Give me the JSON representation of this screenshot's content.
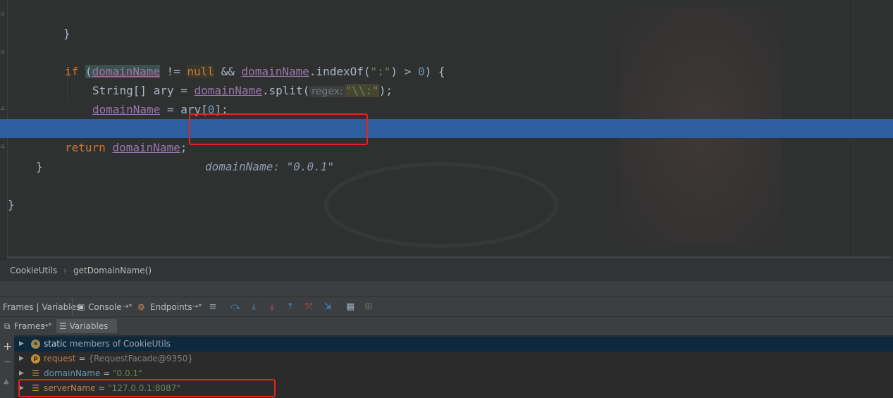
{
  "editor": {
    "lines": [
      {
        "brace": "}"
      },
      {
        "kw_if": "if",
        "paren_open": "(",
        "var1": "domainName",
        "op1": " != ",
        "null_kw": "null",
        "op2": " && ",
        "var2": "domainName",
        "call": ".indexOf(",
        "str1": "\":\"",
        "rest": ") > ",
        "num": "0",
        "close": ") {"
      },
      {
        "type": "String[] ary = ",
        "var": "domainName",
        "call": ".split(",
        "hint": "regex:",
        "str": "\"\\\\:\"",
        "end": ");"
      },
      {
        "var": "domainName",
        "mid": " = ary[",
        "num": "0",
        "end": "];"
      },
      {
        "brace": "}"
      },
      {
        "kw": "return",
        "var": "domainName",
        "end": ";",
        "inline_value": "domainName: \"0.0.1\""
      },
      {
        "brace": "}"
      },
      {
        "brace": "}"
      }
    ]
  },
  "breadcrumb": {
    "class": "CookieUtils",
    "method": "getDomainName()"
  },
  "debug_tabs": {
    "frames_variables": "Frames | Variables",
    "console": "Console",
    "console_pin": "→*",
    "endpoints": "Endpoints",
    "endpoints_pin": "→*"
  },
  "subtabs": {
    "frames": "Frames",
    "frames_pin": "→*",
    "variables": "Variables",
    "variables_pin": "→*"
  },
  "variables": [
    {
      "icon": "s",
      "name": "static",
      "rest": " members of CookieUtils"
    },
    {
      "icon": "p",
      "name": "request",
      "eq": " = ",
      "value": "{RequestFacade@9350}"
    },
    {
      "icon": "f",
      "name": "domainName",
      "eq": " = ",
      "value": "\"0.0.1\""
    },
    {
      "icon": "f",
      "name": "serverName",
      "eq": " = ",
      "value": "\"127.0.0.1:8087\""
    }
  ],
  "colors": {
    "highlight_box": "#e8231f",
    "current_line": "#2d5f9e"
  }
}
